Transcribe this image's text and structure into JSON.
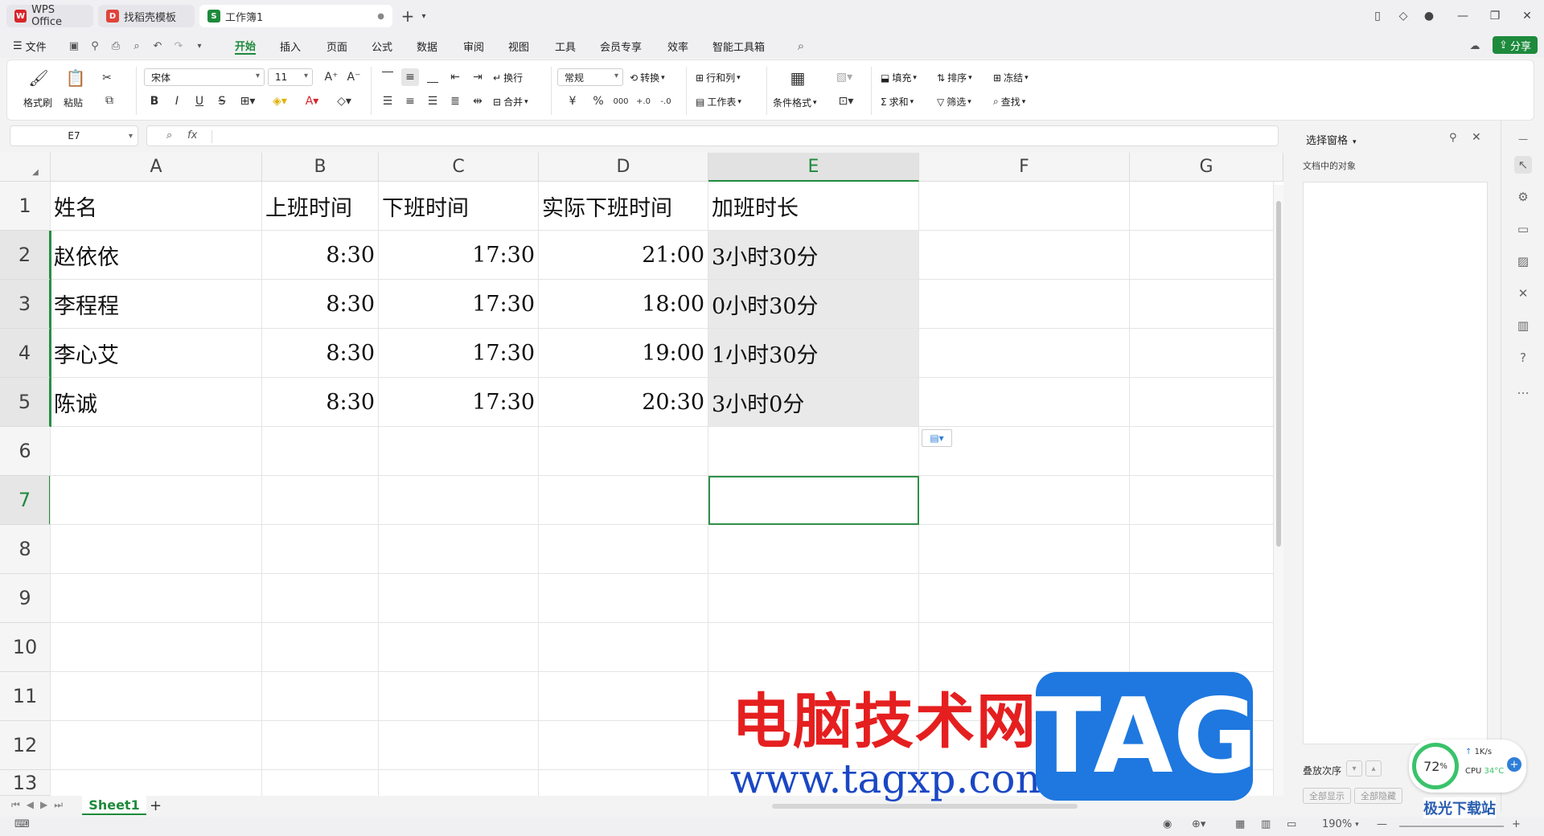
{
  "tabs": [
    {
      "label": "WPS Office"
    },
    {
      "label": "找稻壳模板"
    },
    {
      "label": "工作簿1"
    }
  ],
  "menu": {
    "file": "文件",
    "items": [
      "开始",
      "插入",
      "页面",
      "公式",
      "数据",
      "审阅",
      "视图",
      "工具",
      "会员专享",
      "效率",
      "智能工具箱"
    ],
    "active": "开始",
    "share": "分享"
  },
  "ribbon": {
    "format_painter": "格式刷",
    "paste": "粘贴",
    "font_name": "宋体",
    "font_size": "11",
    "bold": "B",
    "italic": "I",
    "underline": "U",
    "strike": "S",
    "wrap": "换行",
    "merge": "合并",
    "num_format": "常规",
    "convert": "转换",
    "rowcol": "行和列",
    "worksheet": "工作表",
    "cond_format": "条件格式",
    "fill": "填充",
    "sort": "排序",
    "freeze": "冻结",
    "sum": "求和",
    "filter": "筛选",
    "find": "查找",
    "percent": "%",
    "currency": "¥"
  },
  "formula": {
    "name_box": "E7",
    "fx": "fx",
    "value": ""
  },
  "columns": [
    "A",
    "B",
    "C",
    "D",
    "E",
    "F",
    "G"
  ],
  "rows": [
    "1",
    "2",
    "3",
    "4",
    "5",
    "6",
    "7",
    "8",
    "9",
    "10",
    "11",
    "12",
    "13"
  ],
  "table": [
    [
      "姓名",
      "上班时间",
      "下班时间",
      "实际下班时间",
      "加班时长"
    ],
    [
      "赵依依",
      "8:30",
      "17:30",
      "21:00",
      "3小时30分"
    ],
    [
      "李程程",
      "8:30",
      "17:30",
      "18:00",
      "0小时30分"
    ],
    [
      "李心艾",
      "8:30",
      "17:30",
      "19:00",
      "1小时30分"
    ],
    [
      "陈诚",
      "8:30",
      "17:30",
      "20:30",
      "3小时0分"
    ]
  ],
  "pane": {
    "title": "选择窗格",
    "subtitle": "文档中的对象",
    "order_label": "叠放次序",
    "show_all": "全部显示",
    "hide_all": "全部隐藏"
  },
  "sheet_tab": "Sheet1",
  "status": {
    "zoom": "190%"
  },
  "perf": {
    "cpu_percent": "72",
    "speed": "1K/s",
    "cpu_label": "CPU",
    "temp": "34°C"
  },
  "watermark": {
    "line1": "电脑技术网",
    "line2": "www.tagxp.com",
    "tag": "TAG",
    "site": "极光下载站"
  },
  "colors": {
    "accent_green": "#1e8a3c",
    "wps_red": "#d9242b",
    "selection_green": "#2f8f4a"
  }
}
